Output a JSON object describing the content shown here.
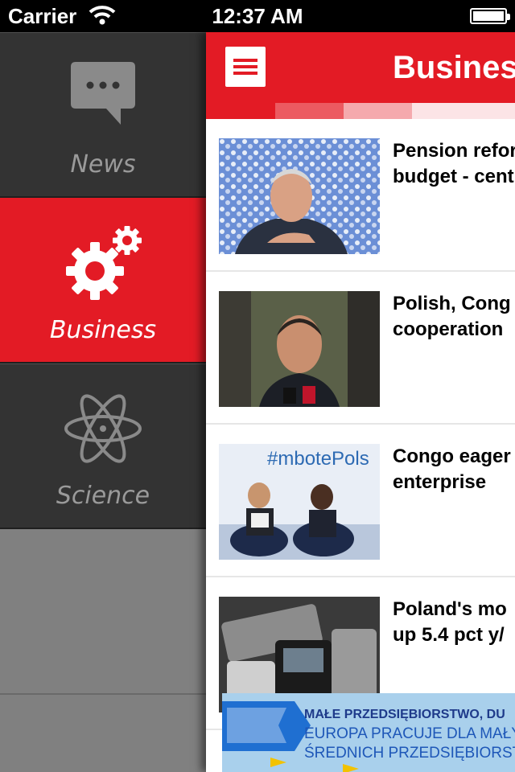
{
  "status_bar": {
    "carrier": "Carrier",
    "time": "12:37 AM",
    "icons": [
      "wifi-icon",
      "battery-icon"
    ]
  },
  "side_menu": {
    "items": [
      {
        "label": "News",
        "icon": "speech-bubble-icon",
        "active": false
      },
      {
        "label": "Business",
        "icon": "gears-icon",
        "active": true
      },
      {
        "label": "Science",
        "icon": "atom-icon",
        "active": false
      }
    ]
  },
  "navbar": {
    "title": "Business",
    "menu_icon": "hamburger-icon"
  },
  "articles": [
    {
      "headline": "Pension reform\nbudget - cent"
    },
    {
      "headline": "Polish, Cong\ncooperation"
    },
    {
      "headline": "Congo eager\nenterprise"
    },
    {
      "headline": "Poland's mo\nup 5.4 pct y/"
    }
  ],
  "thumb_texts": {
    "article_3": "#mbotePols"
  },
  "banner": {
    "line1": "MAŁE PRZEDSIĘBIORSTWO, DU",
    "line2": "EUROPA PRACUJE DLA MAŁYCH",
    "line3": "ŚREDNICH PRZEDSIĘBIORST"
  },
  "colors": {
    "accent": "#e31b25",
    "sidebar": "#333333",
    "sidebar_inactive_text": "#9a9a9a"
  }
}
